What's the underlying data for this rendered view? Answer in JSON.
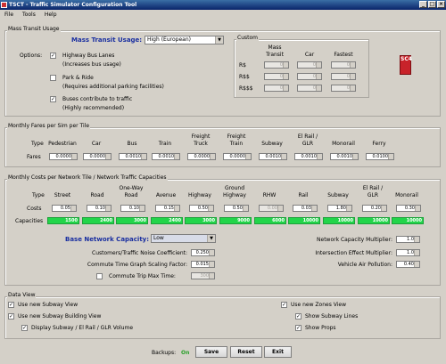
{
  "window": {
    "title": "TSCT - Traffic Simulator Configuration Tool"
  },
  "menu": [
    "File",
    "Tools",
    "Help"
  ],
  "mass_transit": {
    "section": "Mass Transit Usage",
    "usage_label": "Mass Transit Usage:",
    "usage_value": "High (European)",
    "options_label": "Options:",
    "opt1": "Highway Bus Lanes",
    "opt1_sub": "(Increases bus usage)",
    "opt2": "Park & Ride",
    "opt2_sub": "(Requires additional parking facilities)",
    "opt3": "Buses contribute to traffic",
    "opt3_sub": "(Highly recommended)",
    "custom": {
      "legend": "Custom",
      "col1a": "Mass",
      "col1b": "Transit",
      "col2": "Car",
      "col3": "Fastest",
      "rows": [
        {
          "label": "R$",
          "v1": "0",
          "v2": "0",
          "v3": "0"
        },
        {
          "label": "R$$",
          "v1": "0",
          "v2": "0",
          "v3": "0"
        },
        {
          "label": "R$$$",
          "v1": "0",
          "v2": "0",
          "v3": "0"
        }
      ]
    },
    "logo": "SC4"
  },
  "fares": {
    "section": "Monthly Fares per Sim per Tile",
    "type_label": "Type",
    "row_label": "Fares",
    "headers": [
      [
        "",
        "Pedestrian"
      ],
      [
        "",
        "Car"
      ],
      [
        "",
        "Bus"
      ],
      [
        "",
        "Train"
      ],
      [
        "Freight",
        "Truck"
      ],
      [
        "Freight",
        "Train"
      ],
      [
        "",
        "Subway"
      ],
      [
        "El Rail /",
        "GLR"
      ],
      [
        "",
        "Monorail"
      ],
      [
        "",
        "Ferry"
      ]
    ],
    "values": [
      "0.0000",
      "0.0000",
      "0.0010",
      "0.0010",
      "0.0000",
      "0.0000",
      "0.0010",
      "0.0010",
      "0.0010",
      "0.0100"
    ]
  },
  "costs": {
    "section": "Monthly Costs per Network Tile / Network Traffic Capacities",
    "type_label": "Type",
    "costs_label": "Costs",
    "cap_label": "Capacities",
    "headers": [
      [
        "",
        "Street"
      ],
      [
        "",
        "Road"
      ],
      [
        "One-Way",
        "Road"
      ],
      [
        "",
        "Avenue"
      ],
      [
        "",
        "Highway"
      ],
      [
        "Ground",
        "Highway"
      ],
      [
        "",
        "RHW"
      ],
      [
        "",
        "Rail"
      ],
      [
        "",
        "Subway"
      ],
      [
        "El Rail /",
        "GLR"
      ],
      [
        "",
        "Monorail"
      ]
    ],
    "values": [
      "0.05",
      "0.10",
      "0.10",
      "0.15",
      "0.50",
      "0.50",
      "0.00",
      "0.03",
      "1.80",
      "0.20",
      "0.30"
    ],
    "capacities": [
      "1500",
      "2400",
      "3000",
      "2400",
      "3000",
      "9000",
      "6000",
      "10000",
      "10000",
      "10000",
      "10000"
    ],
    "base_label": "Base Network Capacity:",
    "base_value": "Low",
    "noise_label": "Customers/Traffic Noise Coefficient:",
    "noise_value": "0.250",
    "commute_label": "Commute Time Graph Scaling Factor:",
    "commute_value": "0.015",
    "maxtime_label": "Commute Trip Max Time:",
    "maxtime_value": "300",
    "ncm_label": "Network Capacity Multiplier:",
    "ncm_value": "1.0",
    "iem_label": "Intersection Effect Multiplier:",
    "iem_value": "1.0",
    "vap_label": "Vehicle Air Pollution:",
    "vap_value": "0.40"
  },
  "data_view": {
    "section": "Data View",
    "subway_view": "Use new Subway View",
    "subway_building": "Use new Subway Building View",
    "display_vol": "Display Subway / El Rail / GLR Volume",
    "zones_view": "Use new Zones View",
    "show_lines": "Show Subway Lines",
    "show_props": "Show Props"
  },
  "footer": {
    "backups_label": "Backups:",
    "backups_value": "On",
    "save": "Save",
    "reset": "Reset",
    "exit": "Exit"
  },
  "colors": {
    "capacity_bar": "#22d54a",
    "title_blue": "#1a2fa0",
    "backups_on": "#2aa02a"
  }
}
